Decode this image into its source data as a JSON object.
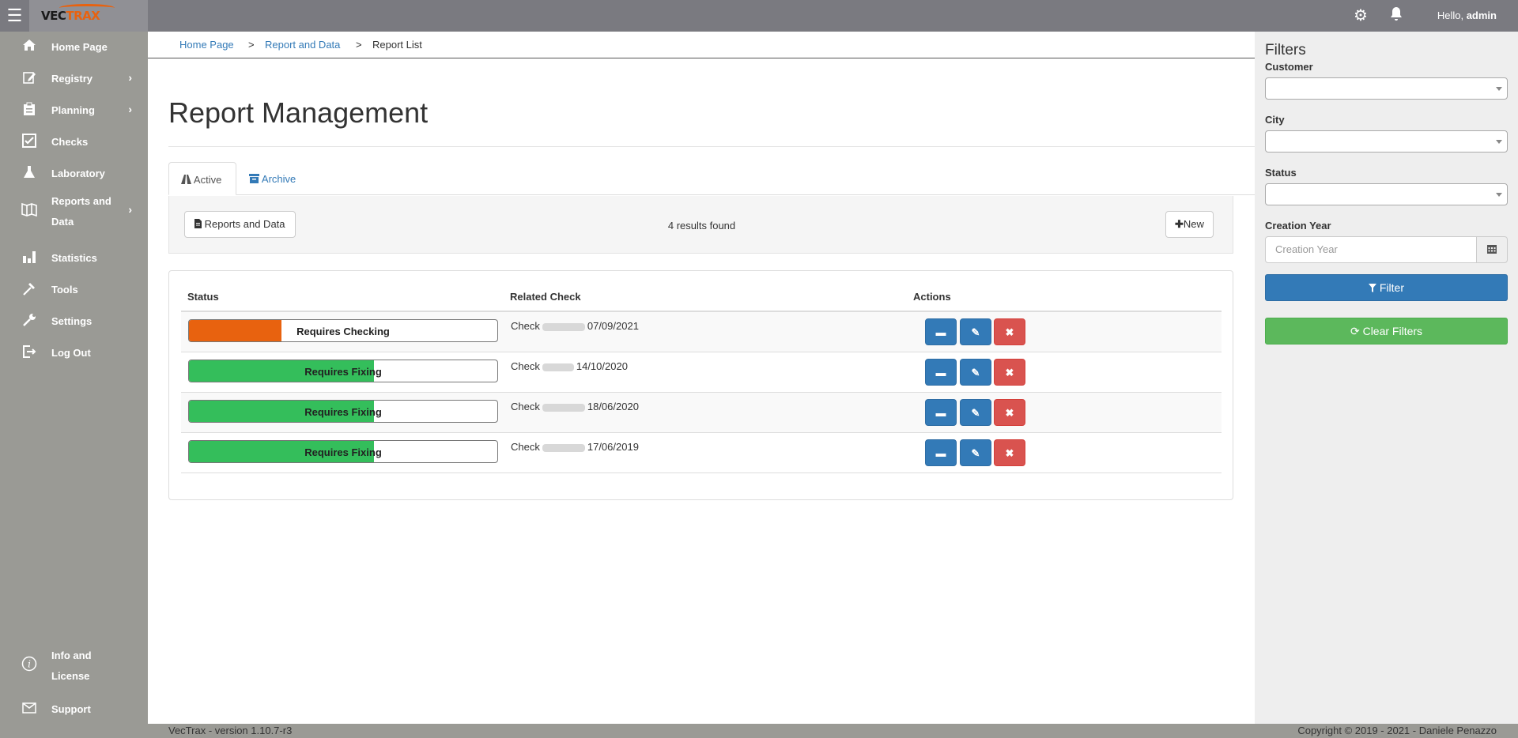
{
  "colors": {
    "topbar": "#7a7a80",
    "sidebar": "#9a9a95",
    "accent_orange": "#e8620f",
    "progress_green": "#34be5b",
    "primary_blue": "#337ab7",
    "danger_red": "#d9534f",
    "success_green": "#5cb85c"
  },
  "topbar": {
    "menu_icon": "hamburger-icon",
    "logo": {
      "part1": "VEC",
      "part2": "TRAX"
    },
    "settings_icon": "gear-icon",
    "notifications_icon": "bell-icon",
    "greeting": "Hello,",
    "username": "admin"
  },
  "sidebar": {
    "items": [
      {
        "label": "Home Page",
        "icon": "home-icon",
        "has_submenu": false
      },
      {
        "label": "Registry",
        "icon": "edit-icon",
        "has_submenu": true
      },
      {
        "label": "Planning",
        "icon": "clipboard-icon",
        "has_submenu": true
      },
      {
        "label": "Checks",
        "icon": "checkbox-icon",
        "has_submenu": false
      },
      {
        "label": "Laboratory",
        "icon": "flask-icon",
        "has_submenu": false
      },
      {
        "label": "Reports and Data",
        "icon": "book-icon",
        "has_submenu": true
      },
      {
        "label": "Statistics",
        "icon": "bar-chart-icon",
        "has_submenu": false
      },
      {
        "label": "Tools",
        "icon": "hammer-icon",
        "has_submenu": false
      },
      {
        "label": "Settings",
        "icon": "wrench-icon",
        "has_submenu": false
      },
      {
        "label": "Log Out",
        "icon": "logout-icon",
        "has_submenu": false
      }
    ],
    "bottom_items": [
      {
        "label": "Info and License",
        "icon": "info-icon"
      },
      {
        "label": "Support",
        "icon": "envelope-icon"
      }
    ],
    "submenu_arrow": "›"
  },
  "breadcrumb": {
    "items": [
      "Home Page",
      "Report and Data",
      "Report List"
    ],
    "separator": ">"
  },
  "page": {
    "title": "Report Management",
    "tabs": [
      {
        "label": "Active",
        "icon": "road-icon",
        "active": true
      },
      {
        "label": "Archive",
        "icon": "archive-icon",
        "active": false
      }
    ],
    "toolbar": {
      "reports_button": "Reports and Data",
      "results_text": "4 results found",
      "new_button": "New"
    }
  },
  "table": {
    "columns": [
      "Status",
      "Related Check",
      "Actions"
    ],
    "rows": [
      {
        "status": "Requires Checking",
        "progress": 0.3,
        "color": "#e8620f",
        "check_prefix": "Check",
        "check_date": "07/09/2021"
      },
      {
        "status": "Requires Fixing",
        "progress": 0.6,
        "color": "#34be5b",
        "check_prefix": "Check",
        "check_date": "14/10/2020"
      },
      {
        "status": "Requires Fixing",
        "progress": 0.6,
        "color": "#34be5b",
        "check_prefix": "Check",
        "check_date": "18/06/2020"
      },
      {
        "status": "Requires Fixing",
        "progress": 0.6,
        "color": "#34be5b",
        "check_prefix": "Check",
        "check_date": "17/06/2019"
      }
    ],
    "actions": [
      {
        "icon": "folder-open-icon",
        "glyph": "▬"
      },
      {
        "icon": "pencil-icon",
        "glyph": "✎"
      },
      {
        "icon": "remove-icon",
        "glyph": "✖"
      }
    ]
  },
  "filters": {
    "title": "Filters",
    "customer_label": "Customer",
    "city_label": "City",
    "status_label": "Status",
    "creation_year_label": "Creation Year",
    "creation_year_placeholder": "Creation Year",
    "filter_button": "Filter",
    "clear_button": "Clear Filters"
  },
  "footer": {
    "version": "VecTrax - version 1.10.7-r3",
    "copyright": "Copyright © 2019 - 2021 - Daniele Penazzo"
  }
}
